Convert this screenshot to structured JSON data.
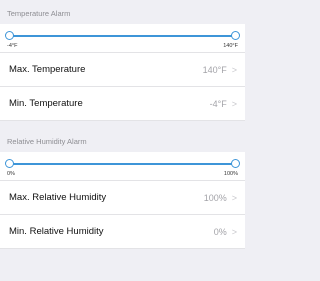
{
  "temperature": {
    "section_title": "Temperature Alarm",
    "slider": {
      "min_label": "-4°F",
      "max_label": "140°F"
    },
    "rows": [
      {
        "label": "Max. Temperature",
        "value": "140°F"
      },
      {
        "label": "Min. Temperature",
        "value": "-4°F"
      }
    ]
  },
  "humidity": {
    "section_title": "Relative Humidity Alarm",
    "slider": {
      "min_label": "0%",
      "max_label": "100%"
    },
    "rows": [
      {
        "label": "Max. Relative Humidity",
        "value": "100%"
      },
      {
        "label": "Min. Relative Humidity",
        "value": "0%"
      }
    ]
  },
  "icons": {
    "row_disclosure": "chevron-right-icon"
  },
  "colors": {
    "accent": "#3d95d8",
    "background": "#efeff4"
  }
}
